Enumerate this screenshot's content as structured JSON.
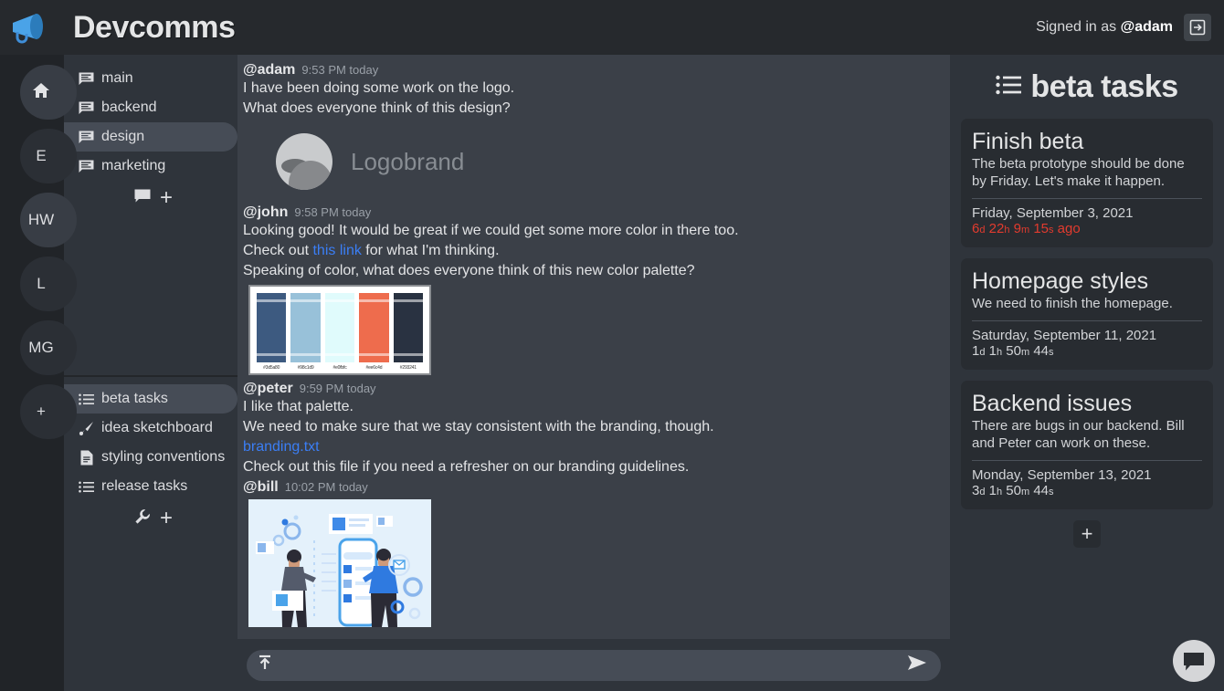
{
  "header": {
    "brand_title": "Devcomms",
    "brand_icon": "megaphone-icon",
    "signed_in_prefix": "Signed in as ",
    "signed_in_user": "@adam",
    "signout_icon": "sign-out-icon"
  },
  "rail": {
    "items": [
      {
        "label": "",
        "icon": "home-icon",
        "active": false
      },
      {
        "label": "E",
        "icon": "",
        "active": false
      },
      {
        "label": "HW",
        "icon": "",
        "active": true
      },
      {
        "label": "L",
        "icon": "",
        "active": false
      },
      {
        "label": "MG",
        "icon": "",
        "active": false
      },
      {
        "label": "+",
        "icon": "plus-icon",
        "active": false
      }
    ]
  },
  "sidebar": {
    "channels": [
      {
        "label": "main",
        "icon": "chat-lines-icon",
        "active": false
      },
      {
        "label": "backend",
        "icon": "chat-lines-icon",
        "active": false
      },
      {
        "label": "design",
        "icon": "chat-lines-icon",
        "active": true
      },
      {
        "label": "marketing",
        "icon": "chat-lines-icon",
        "active": false
      }
    ],
    "add_channel_icon": "chat-bubble-icon",
    "add_channel_plus": "+",
    "tools": [
      {
        "label": "beta tasks",
        "icon": "list-icon",
        "active": true
      },
      {
        "label": "idea sketchboard",
        "icon": "paintbrush-icon",
        "active": false
      },
      {
        "label": "styling conventions",
        "icon": "document-icon",
        "active": false
      },
      {
        "label": "release tasks",
        "icon": "list-icon",
        "active": false
      }
    ],
    "add_tool_icon": "wrench-icon",
    "add_tool_plus": "+"
  },
  "chat": {
    "messages": [
      {
        "author": "@adam",
        "time": "9:53 PM today",
        "lines": [
          "I have been doing some work on the logo.",
          "What does everyone think of this design?"
        ],
        "attachment": {
          "type": "logo",
          "name": "Logobrand"
        }
      },
      {
        "author": "@john",
        "time": "9:58 PM today",
        "lines": [
          "Looking good! It would be great if we could get some more color in there too.",
          "Check out this link for what I'm thinking.",
          "Speaking of color, what does everyone think of this new color palette?"
        ],
        "link_text": "this link",
        "attachment": {
          "type": "palette",
          "swatches": [
            {
              "hex": "#3d5a80",
              "label": "#3d5a80"
            },
            {
              "hex": "#98c1d9",
              "label": "#98c1d9"
            },
            {
              "hex": "#e0fbfc",
              "label": "#e0fbfc"
            },
            {
              "hex": "#ee6c4d",
              "label": "#ee6c4d"
            },
            {
              "hex": "#293241",
              "label": "#293241"
            }
          ]
        }
      },
      {
        "author": "@peter",
        "time": "9:59 PM today",
        "lines": [
          "I like that palette.",
          "We need to make sure that we stay consistent with the branding, though.",
          "branding.txt",
          "Check out this file if you need a refresher on our branding guidelines."
        ],
        "file_link": "branding.txt"
      },
      {
        "author": "@bill",
        "time": "10:02 PM today",
        "lines": [],
        "attachment": {
          "type": "illustration",
          "name": "app-development-illustration"
        }
      }
    ],
    "composer": {
      "value": "",
      "placeholder": "",
      "upload_icon": "upload-icon",
      "send_icon": "send-icon"
    }
  },
  "tasks": {
    "title": "beta tasks",
    "title_icon": "list-icon",
    "add_button": "+",
    "cards": [
      {
        "title": "Finish beta",
        "desc": "The beta prototype should be done by Friday. Let's make it happen.",
        "date": "Friday, September 3, 2021",
        "countdown": [
          {
            "value": "6",
            "unit": "d"
          },
          {
            "value": "22",
            "unit": "h"
          },
          {
            "value": "9",
            "unit": "m"
          },
          {
            "value": "15",
            "unit": "s"
          }
        ],
        "suffix": " ago",
        "overdue": true
      },
      {
        "title": "Homepage styles",
        "desc": "We need to finish the homepage.",
        "date": "Saturday, September 11, 2021",
        "countdown": [
          {
            "value": "1",
            "unit": "d"
          },
          {
            "value": "1",
            "unit": "h"
          },
          {
            "value": "50",
            "unit": "m"
          },
          {
            "value": "44",
            "unit": "s"
          }
        ],
        "suffix": "",
        "overdue": false
      },
      {
        "title": "Backend issues",
        "desc": "There are bugs in our backend. Bill and Peter can work on these.",
        "date": "Monday, September 13, 2021",
        "countdown": [
          {
            "value": "3",
            "unit": "d"
          },
          {
            "value": "1",
            "unit": "h"
          },
          {
            "value": "50",
            "unit": "m"
          },
          {
            "value": "44",
            "unit": "s"
          }
        ],
        "suffix": "",
        "overdue": false
      }
    ]
  },
  "fab": {
    "icon": "chat-bubble-icon"
  },
  "colors": {
    "app_bg": "#23272b",
    "header_bg": "#26292d",
    "sidebar_bg": "#2f343b",
    "chat_bg": "#3b4048",
    "card_bg": "#282c31",
    "accent_blue": "#3b7ef5",
    "overdue_red": "#e23b2e",
    "brand_blue": "#3f8ed8"
  }
}
